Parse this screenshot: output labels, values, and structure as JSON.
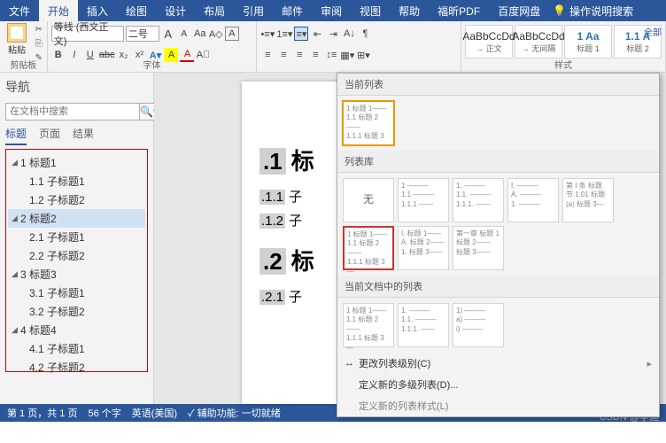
{
  "tabs": {
    "file": "文件",
    "home": "开始",
    "insert": "插入",
    "draw": "绘图",
    "design": "设计",
    "layout": "布局",
    "ref": "引用",
    "mail": "邮件",
    "review": "审阅",
    "view": "视图",
    "help": "帮助",
    "foxit": "福昕PDF",
    "baidu": "百度网盘",
    "tellme": "操作说明搜索"
  },
  "ribbon": {
    "clipboard_label": "剪贴板",
    "paste": "粘贴",
    "font_label": "字体",
    "font_name": "等线 (西文正文)",
    "font_size": "二号",
    "grow": "A",
    "shrink": "A",
    "clear": "Aa",
    "phonetic": "A",
    "bold": "B",
    "italic": "I",
    "uline": "U",
    "strike": "abc",
    "sub": "x₂",
    "sup": "x²",
    "hl": "A",
    "color": "A",
    "styles_label": "样式",
    "s1": "AaBbCcDd",
    "s1n": "→ 正文",
    "s2": "AaBbCcDd",
    "s2n": "→ 无间隔",
    "s3": "1 Aa",
    "s3n": "标题 1",
    "s4": "1.1 A",
    "s4n": "标题 2",
    "all": "全部"
  },
  "nav": {
    "title": "导航",
    "placeholder": "在文档中搜索",
    "tab_headings": "标题",
    "tab_pages": "页面",
    "tab_results": "结果",
    "items": [
      {
        "h": "1 标题1",
        "c": [
          "1.1 子标题1",
          "1.2 子标题2"
        ]
      },
      {
        "h": "2 标题2",
        "c": [
          "2.1 子标题1",
          "2.2 子标题2"
        ]
      },
      {
        "h": "3 标题3",
        "c": [
          "3.1 子标题1",
          "3.2 子标题2"
        ]
      },
      {
        "h": "4 标题4",
        "c": [
          "4.1 子标题1",
          "4.2 子标题2"
        ]
      }
    ]
  },
  "doc": {
    "h1a": {
      "n": ".1",
      "t": "标"
    },
    "h2a": {
      "n": ".1.1",
      "t": "子"
    },
    "h2b": {
      "n": ".1.2",
      "t": "子"
    },
    "h1b": {
      "n": ".2",
      "t": "标"
    },
    "h2c": {
      "n": ".2.1",
      "t": "子"
    }
  },
  "dropdown": {
    "sect1": "当前列表",
    "cur": "1 标题 1——\n1.1 标题 2——\n1.1.1 标题 3—",
    "sect2": "列表库",
    "none": "无",
    "lib": [
      "1 ———\n1.1 ———\n1.1.1 ——",
      "1. ———\n1.1. ———\n1.1.1. ——",
      "I. ———\nA. ———\n1. ———",
      "第 I 条 标题\n节 1.01 标题\n(a) 标题 3—",
      "1 标题 1——\n1.1 标题 2——\n1.1.1 标题 3—",
      "I. 标题 1——\nA. 标题 2——\n1. 标题 3——",
      "第一章 标题 1\n标题 2——\n标题 3——"
    ],
    "sect3": "当前文档中的列表",
    "docl": [
      "1 标题 1——\n1.1 标题 2——\n1.1.1 标题 3—",
      "1. ———\n1.1. ———\n1.1.1. ——",
      "1) ———\na) ———\ni) ———"
    ],
    "m1": "更改列表级别(C)",
    "m2": "定义新的多级列表(D)...",
    "m3": "定义新的列表样式(L)"
  },
  "status": {
    "page": "第 1 页，共 1 页",
    "words": "56 个字",
    "lang": "英语(美国)",
    "acc": "辅助功能: 一切就绪"
  },
  "watermark": "CSDN @李迪"
}
